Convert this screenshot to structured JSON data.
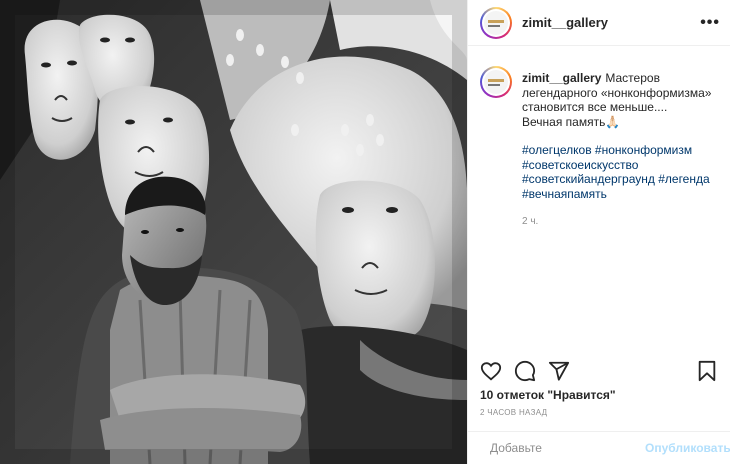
{
  "post": {
    "username": "zimit__gallery",
    "more_icon": "more-horizontal-icon",
    "caption": {
      "username": "zimit__gallery",
      "text": "Мастеров легендарного «нонконформизма» становится все меньше....\nВечная память🙏🏻",
      "hashtags": "#олегцелков #нонконформизм #советскоеискусство #советскийандерграунд #легенда #вечнаяпамять",
      "time_ago": "2 ч."
    },
    "actions": {
      "like_icon": "heart-icon",
      "comment_icon": "comment-icon",
      "share_icon": "share-icon",
      "save_icon": "bookmark-icon"
    },
    "likes_text": "10 отметок \"Нравится\"",
    "posted_text": "2 ЧАСОВ НАЗАД",
    "comment_box": {
      "emoji_icon": "emoji-icon",
      "placeholder": "Добавьте",
      "publish_label": "Опубликовать"
    }
  }
}
